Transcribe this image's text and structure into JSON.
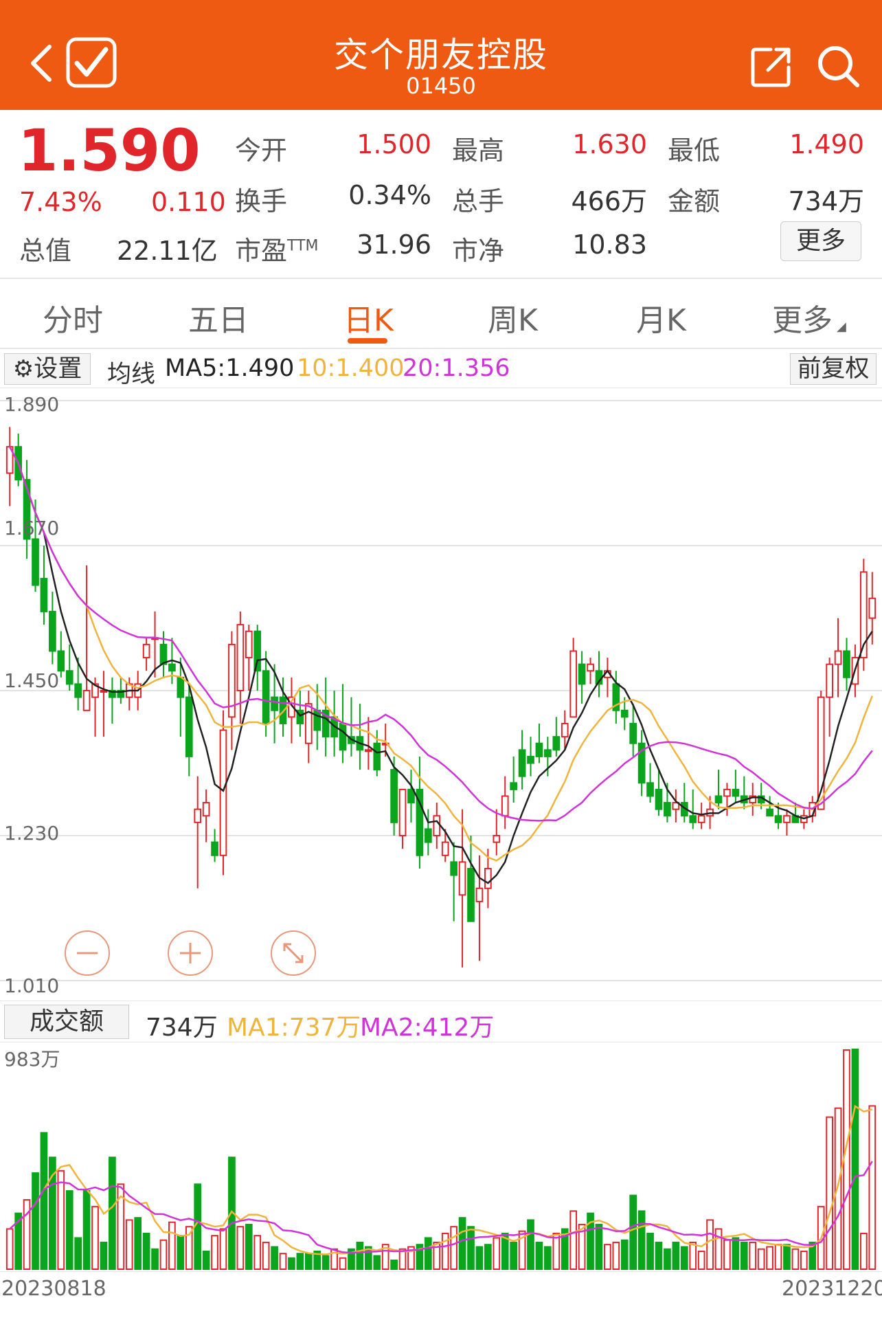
{
  "header": {
    "title": "交个朋友控股",
    "code": "01450",
    "back_icon": "chevron-left-icon",
    "check_icon": "checkbox-checked-icon",
    "share_icon": "share-icon",
    "search_icon": "search-icon"
  },
  "quote": {
    "price": "1.590",
    "change_pct": "7.43%",
    "change": "0.110",
    "open_label": "今开",
    "open": "1.500",
    "high_label": "最高",
    "high": "1.630",
    "low_label": "最低",
    "low": "1.490",
    "turnover_label": "换手",
    "turnover": "0.34%",
    "volume_label": "总手",
    "volume": "466万",
    "amount_label": "金额",
    "amount": "734万",
    "mktcap_label": "总值",
    "mktcap": "22.11亿",
    "pe_label": "市盈",
    "pe_sup": "TTM",
    "pe": "31.96",
    "pb_label": "市净",
    "pb": "10.83",
    "more_label": "更多"
  },
  "tabs": [
    {
      "label": "分时",
      "active": false
    },
    {
      "label": "五日",
      "active": false
    },
    {
      "label": "日K",
      "active": true
    },
    {
      "label": "周K",
      "active": false
    },
    {
      "label": "月K",
      "active": false
    },
    {
      "label": "更多",
      "active": false
    }
  ],
  "ma_bar": {
    "settings_label": "设置",
    "ma_label": "均线",
    "ma5": "MA5:1.490",
    "ma10": "10:1.400",
    "ma20": "20:1.356",
    "adjust_label": "前复权"
  },
  "volume_bar": {
    "label": "成交额",
    "value": "734万",
    "ma1": "MA1:737万",
    "ma2": "MA2:412万"
  },
  "colors": {
    "brand": "#ee5a12",
    "up": "#e0262a",
    "down": "#0aa51c",
    "ma5": "#222222",
    "ma10": "#f0b43c",
    "ma20": "#d033d8"
  },
  "chart_data": [
    {
      "type": "candlestick",
      "y_ticks": [
        "1.890",
        "1.670",
        "1.450",
        "1.230",
        "1.010"
      ],
      "ylim": [
        1.01,
        1.89
      ],
      "x_labels": [
        "20230818",
        "20231220"
      ],
      "ohlc": [
        [
          1.78,
          1.85,
          1.73,
          1.82
        ],
        [
          1.82,
          1.84,
          1.76,
          1.77
        ],
        [
          1.77,
          1.8,
          1.65,
          1.68
        ],
        [
          1.68,
          1.74,
          1.6,
          1.61
        ],
        [
          1.62,
          1.67,
          1.55,
          1.57
        ],
        [
          1.57,
          1.6,
          1.49,
          1.51
        ],
        [
          1.51,
          1.54,
          1.47,
          1.48
        ],
        [
          1.48,
          1.52,
          1.45,
          1.46
        ],
        [
          1.46,
          1.5,
          1.42,
          1.44
        ],
        [
          1.42,
          1.64,
          1.42,
          1.45
        ],
        [
          1.44,
          1.47,
          1.38,
          1.46
        ],
        [
          1.45,
          1.48,
          1.38,
          1.45
        ],
        [
          1.45,
          1.47,
          1.4,
          1.44
        ],
        [
          1.45,
          1.47,
          1.43,
          1.44
        ],
        [
          1.44,
          1.47,
          1.42,
          1.46
        ],
        [
          1.44,
          1.48,
          1.42,
          1.46
        ],
        [
          1.5,
          1.53,
          1.48,
          1.52
        ],
        [
          1.53,
          1.57,
          1.47,
          1.53
        ],
        [
          1.52,
          1.54,
          1.47,
          1.49
        ],
        [
          1.49,
          1.53,
          1.46,
          1.48
        ],
        [
          1.47,
          1.5,
          1.38,
          1.44
        ],
        [
          1.44,
          1.46,
          1.32,
          1.35
        ],
        [
          1.25,
          1.32,
          1.15,
          1.27
        ],
        [
          1.26,
          1.3,
          1.22,
          1.28
        ],
        [
          1.22,
          1.24,
          1.19,
          1.2
        ],
        [
          1.2,
          1.42,
          1.17,
          1.39
        ],
        [
          1.41,
          1.54,
          1.36,
          1.52
        ],
        [
          1.45,
          1.57,
          1.4,
          1.55
        ],
        [
          1.5,
          1.55,
          1.45,
          1.54
        ],
        [
          1.54,
          1.55,
          1.45,
          1.48
        ],
        [
          1.48,
          1.51,
          1.38,
          1.4
        ],
        [
          1.44,
          1.49,
          1.37,
          1.42
        ],
        [
          1.44,
          1.47,
          1.38,
          1.4
        ],
        [
          1.41,
          1.47,
          1.37,
          1.44
        ],
        [
          1.42,
          1.45,
          1.38,
          1.4
        ],
        [
          1.37,
          1.45,
          1.34,
          1.43
        ],
        [
          1.42,
          1.46,
          1.36,
          1.39
        ],
        [
          1.42,
          1.47,
          1.35,
          1.38
        ],
        [
          1.41,
          1.45,
          1.35,
          1.38
        ],
        [
          1.4,
          1.46,
          1.34,
          1.36
        ],
        [
          1.38,
          1.44,
          1.35,
          1.37
        ],
        [
          1.38,
          1.43,
          1.33,
          1.36
        ],
        [
          1.36,
          1.41,
          1.33,
          1.36
        ],
        [
          1.37,
          1.39,
          1.32,
          1.33
        ],
        [
          1.37,
          1.4,
          1.35,
          1.37
        ],
        [
          1.33,
          1.35,
          1.23,
          1.25
        ],
        [
          1.23,
          1.3,
          1.21,
          1.3
        ],
        [
          1.3,
          1.33,
          1.25,
          1.28
        ],
        [
          1.3,
          1.35,
          1.18,
          1.2
        ],
        [
          1.24,
          1.27,
          1.2,
          1.22
        ],
        [
          1.23,
          1.28,
          1.21,
          1.26
        ],
        [
          1.2,
          1.24,
          1.19,
          1.22
        ],
        [
          1.19,
          1.22,
          1.1,
          1.17
        ],
        [
          1.14,
          1.27,
          1.03,
          1.19
        ],
        [
          1.18,
          1.23,
          1.1,
          1.1
        ],
        [
          1.13,
          1.2,
          1.04,
          1.15
        ],
        [
          1.15,
          1.21,
          1.12,
          1.18
        ],
        [
          1.22,
          1.27,
          1.2,
          1.23
        ],
        [
          1.26,
          1.32,
          1.24,
          1.29
        ],
        [
          1.31,
          1.35,
          1.28,
          1.3
        ],
        [
          1.36,
          1.39,
          1.3,
          1.32
        ],
        [
          1.35,
          1.38,
          1.32,
          1.34
        ],
        [
          1.37,
          1.4,
          1.34,
          1.35
        ],
        [
          1.36,
          1.38,
          1.32,
          1.35
        ],
        [
          1.38,
          1.41,
          1.35,
          1.36
        ],
        [
          1.38,
          1.42,
          1.36,
          1.4
        ],
        [
          1.41,
          1.53,
          1.41,
          1.51
        ],
        [
          1.49,
          1.51,
          1.43,
          1.46
        ],
        [
          1.48,
          1.5,
          1.46,
          1.49
        ],
        [
          1.48,
          1.51,
          1.44,
          1.46
        ],
        [
          1.47,
          1.5,
          1.44,
          1.48
        ],
        [
          1.46,
          1.48,
          1.4,
          1.42
        ],
        [
          1.42,
          1.44,
          1.39,
          1.41
        ],
        [
          1.4,
          1.43,
          1.35,
          1.37
        ],
        [
          1.37,
          1.39,
          1.29,
          1.31
        ],
        [
          1.31,
          1.34,
          1.28,
          1.29
        ],
        [
          1.3,
          1.33,
          1.26,
          1.27
        ],
        [
          1.28,
          1.31,
          1.25,
          1.26
        ],
        [
          1.27,
          1.3,
          1.25,
          1.28
        ],
        [
          1.28,
          1.31,
          1.25,
          1.26
        ],
        [
          1.26,
          1.3,
          1.24,
          1.25
        ],
        [
          1.25,
          1.28,
          1.24,
          1.26
        ],
        [
          1.26,
          1.29,
          1.24,
          1.27
        ],
        [
          1.29,
          1.33,
          1.27,
          1.28
        ],
        [
          1.29,
          1.31,
          1.26,
          1.3
        ],
        [
          1.3,
          1.33,
          1.28,
          1.29
        ],
        [
          1.29,
          1.32,
          1.27,
          1.28
        ],
        [
          1.28,
          1.31,
          1.26,
          1.29
        ],
        [
          1.29,
          1.31,
          1.27,
          1.28
        ],
        [
          1.27,
          1.29,
          1.26,
          1.26
        ],
        [
          1.26,
          1.28,
          1.24,
          1.25
        ],
        [
          1.25,
          1.27,
          1.23,
          1.26
        ],
        [
          1.26,
          1.28,
          1.25,
          1.25
        ],
        [
          1.25,
          1.27,
          1.24,
          1.26
        ],
        [
          1.26,
          1.29,
          1.25,
          1.28
        ],
        [
          1.27,
          1.45,
          1.27,
          1.44
        ],
        [
          1.44,
          1.5,
          1.38,
          1.49
        ],
        [
          1.49,
          1.56,
          1.44,
          1.51
        ],
        [
          1.51,
          1.53,
          1.45,
          1.47
        ],
        [
          1.46,
          1.52,
          1.44,
          1.5
        ],
        [
          1.5,
          1.65,
          1.48,
          1.63
        ],
        [
          1.56,
          1.63,
          1.52,
          1.59
        ]
      ]
    },
    {
      "type": "bar",
      "title": "成交额",
      "y_ticks": [
        "983万"
      ],
      "ylim": [
        0,
        983
      ],
      "values": [
        [
          180,
          1
        ],
        [
          250,
          0
        ],
        [
          310,
          1
        ],
        [
          430,
          0
        ],
        [
          610,
          0
        ],
        [
          500,
          0
        ],
        [
          440,
          1
        ],
        [
          350,
          0
        ],
        [
          140,
          0
        ],
        [
          350,
          0
        ],
        [
          280,
          1
        ],
        [
          120,
          0
        ],
        [
          500,
          0
        ],
        [
          380,
          1
        ],
        [
          220,
          1
        ],
        [
          230,
          0
        ],
        [
          160,
          0
        ],
        [
          90,
          0
        ],
        [
          130,
          1
        ],
        [
          210,
          1
        ],
        [
          150,
          0
        ],
        [
          190,
          1
        ],
        [
          380,
          0
        ],
        [
          80,
          0
        ],
        [
          150,
          1
        ],
        [
          180,
          1
        ],
        [
          500,
          0
        ],
        [
          190,
          1
        ],
        [
          200,
          0
        ],
        [
          150,
          1
        ],
        [
          120,
          1
        ],
        [
          100,
          0
        ],
        [
          70,
          1
        ],
        [
          50,
          0
        ],
        [
          70,
          0
        ],
        [
          70,
          0
        ],
        [
          80,
          0
        ],
        [
          60,
          0
        ],
        [
          90,
          1
        ],
        [
          50,
          1
        ],
        [
          90,
          0
        ],
        [
          120,
          0
        ],
        [
          100,
          0
        ],
        [
          60,
          0
        ],
        [
          110,
          1
        ],
        [
          40,
          0
        ],
        [
          90,
          1
        ],
        [
          100,
          1
        ],
        [
          110,
          0
        ],
        [
          140,
          0
        ],
        [
          120,
          1
        ],
        [
          160,
          1
        ],
        [
          190,
          1
        ],
        [
          230,
          0
        ],
        [
          190,
          0
        ],
        [
          100,
          0
        ],
        [
          110,
          0
        ],
        [
          140,
          1
        ],
        [
          160,
          0
        ],
        [
          120,
          0
        ],
        [
          170,
          1
        ],
        [
          220,
          0
        ],
        [
          120,
          0
        ],
        [
          100,
          0
        ],
        [
          160,
          1
        ],
        [
          180,
          0
        ],
        [
          260,
          1
        ],
        [
          200,
          1
        ],
        [
          250,
          0
        ],
        [
          200,
          0
        ],
        [
          110,
          1
        ],
        [
          120,
          1
        ],
        [
          130,
          0
        ],
        [
          330,
          0
        ],
        [
          260,
          0
        ],
        [
          160,
          0
        ],
        [
          120,
          0
        ],
        [
          90,
          0
        ],
        [
          120,
          0
        ],
        [
          100,
          0
        ],
        [
          120,
          1
        ],
        [
          80,
          1
        ],
        [
          220,
          1
        ],
        [
          180,
          1
        ],
        [
          130,
          1
        ],
        [
          140,
          0
        ],
        [
          120,
          0
        ],
        [
          120,
          1
        ],
        [
          90,
          1
        ],
        [
          100,
          1
        ],
        [
          110,
          1
        ],
        [
          110,
          0
        ],
        [
          90,
          1
        ],
        [
          80,
          1
        ],
        [
          120,
          0
        ],
        [
          280,
          1
        ],
        [
          680,
          1
        ],
        [
          720,
          1
        ],
        [
          980,
          1
        ],
        [
          983,
          0
        ],
        [
          160,
          1
        ],
        [
          730,
          1
        ]
      ]
    }
  ]
}
